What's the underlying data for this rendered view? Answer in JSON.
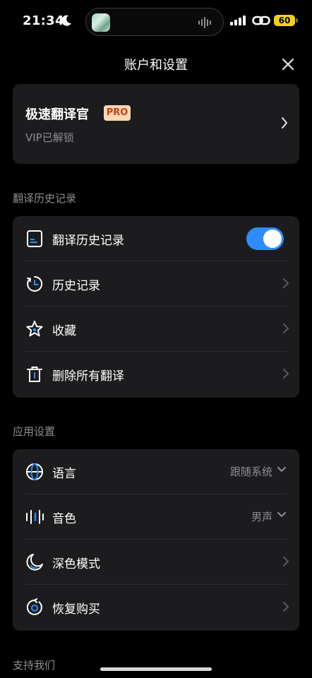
{
  "status_bar": {
    "time": "21:34",
    "battery": "60",
    "battery_color": "#f2d11b"
  },
  "header": {
    "title": "账户和设置",
    "close_icon": "close-icon"
  },
  "account": {
    "app_name": "极速翻译官",
    "badge": "PRO",
    "status": "VIP已解锁"
  },
  "history_section": {
    "title": "翻译历史记录",
    "items": [
      {
        "label": "翻译历史记录",
        "icon": "document-icon",
        "toggle_on": true
      },
      {
        "label": "历史记录",
        "icon": "history-icon"
      },
      {
        "label": "收藏",
        "icon": "star-icon"
      },
      {
        "label": "删除所有翻译",
        "icon": "trash-icon"
      }
    ]
  },
  "app_settings": {
    "title": "应用设置",
    "items": [
      {
        "label": "语言",
        "icon": "globe-icon",
        "value": "跟随系统"
      },
      {
        "label": "音色",
        "icon": "voice-icon",
        "value": "男声"
      },
      {
        "label": "深色模式",
        "icon": "moon-icon"
      },
      {
        "label": "恢复购买",
        "icon": "restore-icon"
      }
    ]
  },
  "support_section": {
    "title": "支持我们"
  },
  "colors": {
    "accent": "#2f8cff",
    "card_background": "#1c1c1e",
    "badge_background": "#ffd9b3",
    "badge_text": "#c2411a"
  }
}
